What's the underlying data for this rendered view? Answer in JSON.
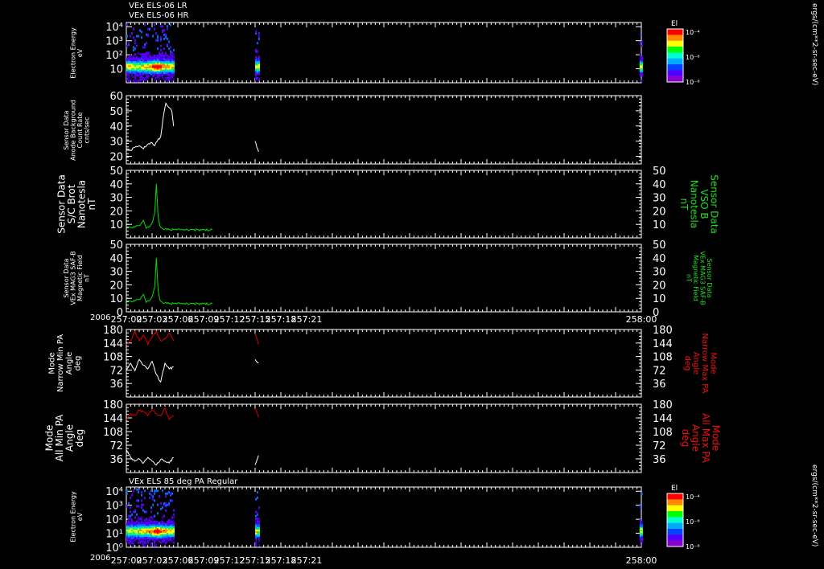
{
  "headers": {
    "top_line1": "VEx ELS-06 LR",
    "top_line2": "VEx ELS-06 HR",
    "bottom": "VEx ELS 85 deg PA Regular"
  },
  "year_label": "2006",
  "x_ticks": [
    "257:00",
    "257:03",
    "257:06",
    "257:09",
    "257:12",
    "257:15",
    "257:18",
    "257:21",
    "258:00"
  ],
  "colorbar": {
    "title": "El",
    "ticks": [
      "10⁻⁴",
      "10⁻⁶",
      "10⁻⁸"
    ],
    "unit_label": "ergs/(cm**2-sr-sec-eV)"
  },
  "panel_labels": {
    "p1": "Electron Energy\neV",
    "p2": "Sensor Data\nAnode Background\nCount Rate\ncnts/sec",
    "p3": "Sensor Data\nS/C Brot\nNanotesla\nnT",
    "p3r": "Sensor Data\nVSO B\nNanotesla\nnT",
    "p4": "Sensor Data\nVEx MAG3 SAF-B\nMagnetic Field\nnT",
    "p4r": "Sensor Data\nVEx MAG3 SAF-B\nMagnetic Field\nnT",
    "p5": "Mode\nNarrow Min PA\nAngle\ndeg",
    "p5r": "Mode\nNarrow Max PA\nAngle\ndeg",
    "p6": "Mode\nAll Min PA\nAngle\ndeg",
    "p6r": "Mode\nAll Max PA\nAngle\ndeg",
    "p7": "Electron Energy\neV"
  },
  "axes": {
    "energy_ticks": [
      "10⁴",
      "10³",
      "10²",
      "10"
    ],
    "energy_ticks_bottom": [
      "10⁴",
      "10³",
      "10²",
      "10¹",
      "10⁰"
    ],
    "background_ticks": [
      "60",
      "50",
      "40",
      "30",
      "20"
    ],
    "b_ticks": [
      "50",
      "40",
      "30",
      "20",
      "10"
    ],
    "b_ticks_with_zero": [
      "50",
      "40",
      "30",
      "20",
      "10",
      "0"
    ],
    "pa_ticks": [
      "180",
      "144",
      "108",
      "72",
      "36"
    ]
  },
  "colors": {
    "white_trace": "#ffffff",
    "b_trace": "#00dd00",
    "max_pa_trace": "#dd0000",
    "green_label": "#22dd22",
    "red_label": "#ee1111"
  },
  "chart_data": [
    {
      "type": "heatmap",
      "title": "VEx ELS-06 LR / VEx ELS-06 HR",
      "ylabel": "Electron Energy eV",
      "x_range": [
        "257:00",
        "258:00"
      ],
      "y_scale": "log",
      "ylim": [
        1,
        20000
      ],
      "data_intervals_hhmm": [
        [
          "257:00",
          "257:05.5"
        ],
        [
          "257:15",
          "257:15.4"
        ],
        [
          "257:59.8",
          "258:00"
        ]
      ],
      "peak_time": "257:03.5"
    },
    {
      "type": "line",
      "ylabel": "Sensor Data Anode Background Count Rate cnts/sec",
      "ylim": [
        15,
        60
      ],
      "series": [
        {
          "name": "",
          "x_min": [
            0,
            0.5,
            1,
            1.5,
            2,
            2.5,
            3,
            3.3,
            3.6,
            4,
            4.3,
            4.6,
            5,
            5.3,
            5.5,
            15,
            15.2,
            15.4,
            59.9
          ],
          "values": [
            25,
            24,
            26,
            27,
            25,
            28,
            29,
            27,
            30,
            33,
            46,
            55,
            52,
            50,
            40,
            30,
            26,
            23,
            24
          ]
        }
      ]
    },
    {
      "type": "line",
      "ylabel": "Sensor Data S/C Brot Nanotesla nT",
      "ylim": [
        0,
        50
      ],
      "series": [
        {
          "name": "VSO B",
          "x_min": [
            0,
            1,
            1.5,
            2,
            2.3,
            2.6,
            2.9,
            3.1,
            3.3,
            3.5,
            3.7,
            3.9,
            4.2,
            5,
            10,
            20,
            30,
            40,
            50,
            60
          ],
          "values": [
            8,
            8,
            9,
            13,
            7,
            8,
            10,
            13,
            18,
            40,
            16,
            9,
            7,
            6,
            6,
            6,
            6,
            6,
            6,
            6
          ]
        }
      ]
    },
    {
      "type": "line",
      "ylabel": "Sensor Data VEx MAG3 SAF-B Magnetic Field nT",
      "ylim": [
        0,
        50
      ],
      "series": [
        {
          "name": "",
          "x_min": [
            0,
            1,
            1.5,
            2,
            2.3,
            2.6,
            2.9,
            3.1,
            3.3,
            3.5,
            3.7,
            3.9,
            4.2,
            5,
            10,
            20,
            30,
            40,
            50,
            60
          ],
          "values": [
            8,
            8,
            9,
            13,
            7,
            8,
            10,
            13,
            18,
            40,
            16,
            9,
            7,
            6,
            6,
            6,
            6,
            6,
            6,
            6
          ]
        }
      ]
    },
    {
      "type": "line",
      "ylabel": "Mode Narrow Min PA Angle deg / Mode Narrow Max PA Angle deg",
      "ylim": [
        0,
        180
      ],
      "series": [
        {
          "name": "",
          "x_min": [
            0,
            0.5,
            1,
            1.5,
            2,
            2.5,
            3,
            3.5,
            4,
            4.5,
            5,
            5.5,
            15,
            15.4
          ],
          "values": [
            72,
            90,
            70,
            100,
            85,
            75,
            95,
            60,
            40,
            90,
            75,
            80,
            100,
            90
          ]
        },
        {
          "name": "",
          "x_min": [
            0,
            0.5,
            1,
            1.5,
            2,
            2.5,
            3,
            3.5,
            4,
            4.5,
            5,
            5.5,
            15,
            15.4
          ],
          "values": [
            140,
            150,
            175,
            150,
            165,
            140,
            160,
            175,
            150,
            155,
            170,
            150,
            170,
            140
          ]
        }
      ]
    },
    {
      "type": "line",
      "ylabel": "Mode All Min PA Angle deg / Mode All Max PA Angle deg",
      "ylim": [
        0,
        180
      ],
      "series": [
        {
          "name": "",
          "x_min": [
            0,
            0.5,
            1,
            1.5,
            2,
            2.5,
            3,
            3.5,
            4,
            4.5,
            5,
            5.5,
            15,
            15.4
          ],
          "values": [
            60,
            40,
            30,
            36,
            25,
            40,
            30,
            20,
            35,
            30,
            25,
            40,
            20,
            45
          ]
        },
        {
          "name": "",
          "x_min": [
            0,
            0.5,
            1,
            1.5,
            2,
            2.5,
            3,
            3.5,
            4,
            4.5,
            5,
            5.5,
            15,
            15.4
          ],
          "values": [
            140,
            155,
            150,
            165,
            160,
            150,
            165,
            155,
            150,
            170,
            140,
            150,
            170,
            145
          ]
        }
      ]
    },
    {
      "type": "heatmap",
      "title": "VEx ELS 85 deg PA Regular",
      "ylabel": "Electron Energy eV",
      "x_range": [
        "257:00",
        "258:00"
      ],
      "y_scale": "log",
      "ylim": [
        1,
        20000
      ],
      "data_intervals_hhmm": [
        [
          "257:00",
          "257:05.5"
        ],
        [
          "257:15",
          "257:15.4"
        ],
        [
          "257:59.8",
          "258:00"
        ]
      ],
      "peak_time": "257:03.5"
    }
  ]
}
